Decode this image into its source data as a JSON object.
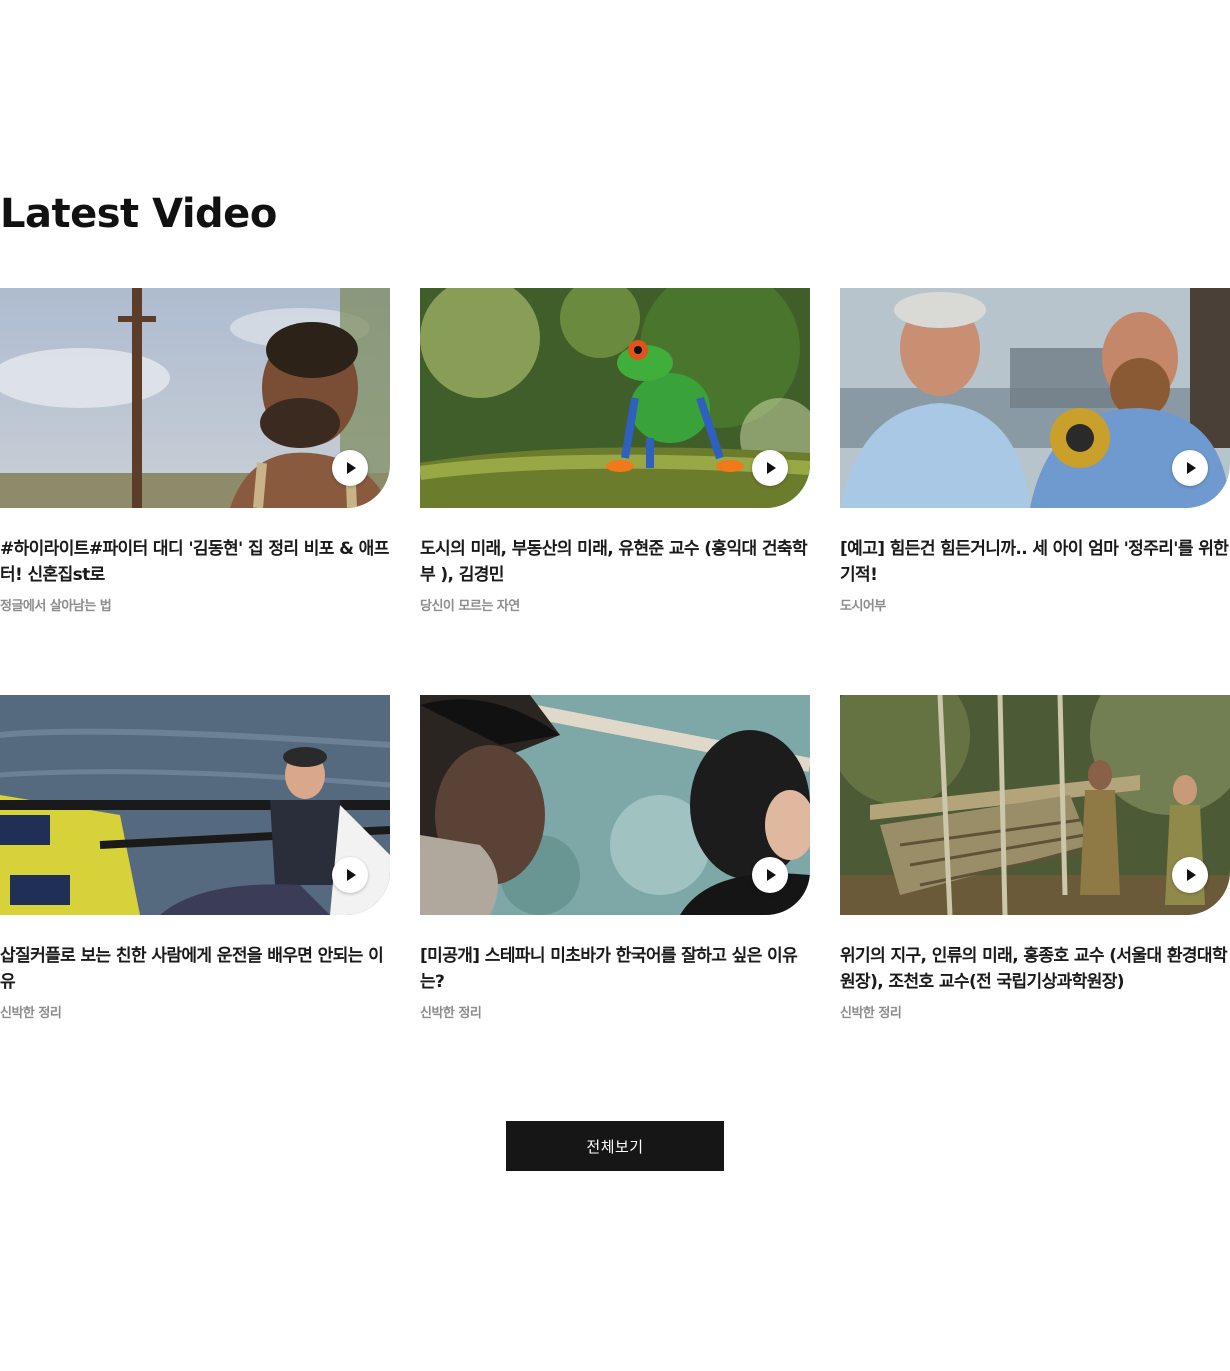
{
  "section": {
    "title": "Latest Video"
  },
  "videos": [
    {
      "title": "#하이라이트#파이터 대디 '김동현' 집 정리 비포 & 애프터! 신혼집st로",
      "category": "정글에서 살아남는 법"
    },
    {
      "title": "도시의 미래, 부동산의 미래, 유현준 교수 (홍익대 건축학부 ), 김경민",
      "category": "당신이 모르는 자연"
    },
    {
      "title": "[예고] 힘든건 힘든거니까.. 세 아이 엄마 '정주리'를 위한 기적!",
      "category": "도시어부"
    },
    {
      "title": "삽질커플로 보는 친한 사람에게 운전을 배우면 안되는 이유",
      "category": "신박한 정리"
    },
    {
      "title": "[미공개] 스테파니 미초바가 한국어를 잘하고 싶은 이유는?",
      "category": "신박한 정리"
    },
    {
      "title": "위기의 지구, 인류의 미래, 홍종호 교수 (서울대 환경대학원장), 조천호 교수(전 국립기상과학원장)",
      "category": "신박한 정리"
    }
  ],
  "view_all_label": "전체보기",
  "icons": {
    "play": "play-icon"
  }
}
